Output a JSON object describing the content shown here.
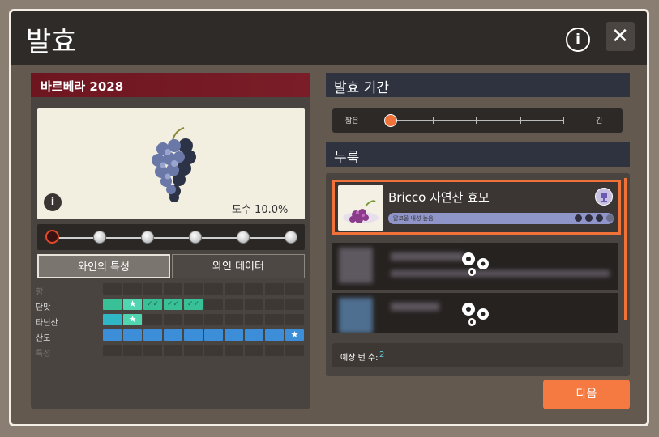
{
  "window": {
    "title": "발효",
    "info_icon": "info-icon",
    "close_icon": "close-icon",
    "close_glyph": "✕"
  },
  "wine": {
    "name": "바르베라 2028",
    "abv": "도수 10.0%",
    "stages_total": 6,
    "current_stage": 1,
    "tabs": [
      "와인의 특성",
      "와인 데이터"
    ],
    "active_tab": 0,
    "characteristics": [
      {
        "label": "향",
        "filled": 0
      },
      {
        "label": "단맛",
        "filled": 5,
        "color": "#38c096"
      },
      {
        "label": "타닌산",
        "filled": 2,
        "color": "#30b7c6"
      },
      {
        "label": "산도",
        "filled": 10,
        "color": "#3d8ed8"
      },
      {
        "label": "특성",
        "filled": 0
      }
    ]
  },
  "fermentation": {
    "duration_heading": "발효 기간",
    "short_label": "짧은",
    "long_label": "긴",
    "duration_level": 0,
    "yeast_heading": "누룩",
    "yeast": {
      "name": "Bricco 자연산 효모",
      "bar_label": "알코올 내성 높음"
    },
    "estimated_turns_label": "예상 턴 수:",
    "estimated_turns": "2"
  },
  "next_button": "다음",
  "colors": {
    "accent": "#f07238",
    "wine_red": "#6e1620"
  }
}
